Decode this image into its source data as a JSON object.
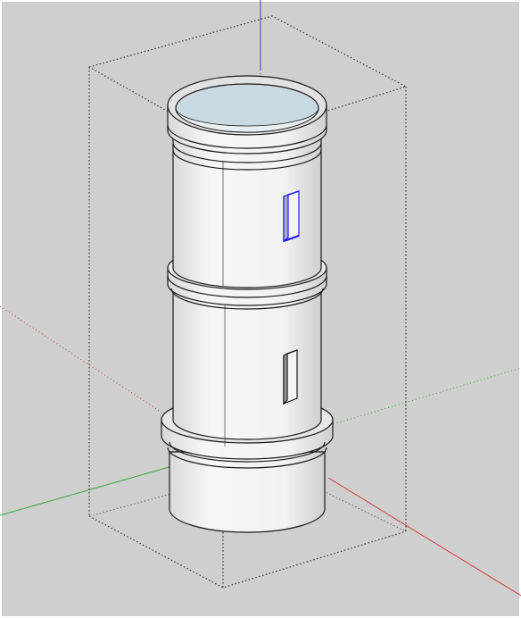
{
  "scene": {
    "background_color": "#cfcfcf",
    "frame_color": "#ffffff",
    "model_fill": "#ececec",
    "model_stroke": "#1a1a1a",
    "inner_fill": "#c9d9e2",
    "selection_color": "#1a1aff",
    "axis_colors": {
      "red": "#d23b3b",
      "green": "#3aa63a",
      "blue": "#3a3ad8"
    }
  }
}
